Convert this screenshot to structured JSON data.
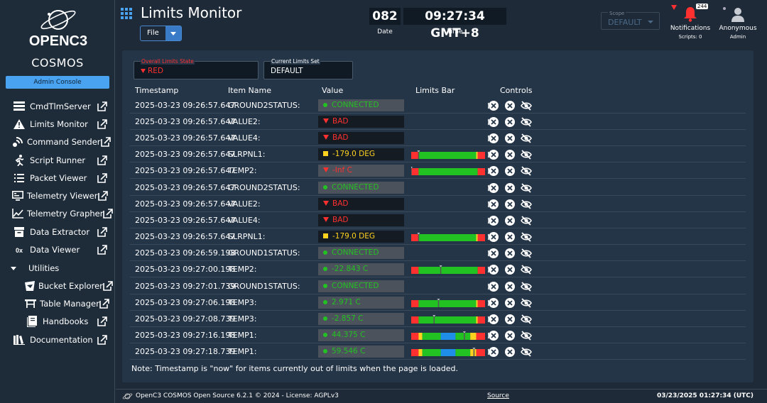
{
  "sidebar": {
    "logo_text": "OPENC3",
    "brand": "COSMOS",
    "admin_label": "Admin Console",
    "items": [
      {
        "label": "CmdTlmServer",
        "icon": "server-icon"
      },
      {
        "label": "Limits Monitor",
        "icon": "warning-icon"
      },
      {
        "label": "Command Sender",
        "icon": "satellite-icon"
      },
      {
        "label": "Script Runner",
        "icon": "runner-icon"
      },
      {
        "label": "Packet Viewer",
        "icon": "list-icon"
      },
      {
        "label": "Telemetry Viewer",
        "icon": "monitor-icon"
      },
      {
        "label": "Telemetry Grapher",
        "icon": "chart-icon"
      },
      {
        "label": "Data Extractor",
        "icon": "archive-icon"
      },
      {
        "label": "Data Viewer",
        "icon": "hex-icon"
      }
    ],
    "utilities_label": "Utilities",
    "utilities": [
      {
        "label": "Bucket Explorer",
        "icon": "bucket-icon"
      },
      {
        "label": "Table Manager",
        "icon": "table-icon"
      },
      {
        "label": "Handbooks",
        "icon": "book-icon"
      }
    ],
    "documentation_label": "Documentation",
    "hex_glyph": "0x"
  },
  "header": {
    "title": "Limits Monitor",
    "file_label": "File",
    "date_value": "082",
    "date_label": "Date",
    "time_value": "09:27:34 GMT+8",
    "time_label": "Time",
    "scope_label": "Scope",
    "scope_value": "DEFAULT",
    "notifications_label": "Notifications",
    "notifications_count": "244",
    "scripts_label": "Scripts: 0",
    "user_label": "Anonymous",
    "user_role": "Admin"
  },
  "limits": {
    "overall_label": "Overall Limits State",
    "overall_value": "RED",
    "current_set_label": "Current Limits Set",
    "current_set_value": "DEFAULT",
    "columns": [
      "Timestamp",
      "Item Name",
      "Value",
      "Limits Bar",
      "Controls"
    ],
    "rows": [
      {
        "ts": "2025-03-23 09:26:57.647",
        "item": "GROUND2STATUS:",
        "value": "CONNECTED",
        "state": "green",
        "bar": null
      },
      {
        "ts": "2025-03-23 09:26:57.647",
        "item": "VALUE2:",
        "value": "BAD",
        "state": "red",
        "bar": null
      },
      {
        "ts": "2025-03-23 09:26:57.647",
        "item": "VALUE4:",
        "value": "BAD",
        "state": "red",
        "bar": null
      },
      {
        "ts": "2025-03-23 09:26:57.647",
        "item": "SLRPNL1:",
        "value": "-179.0 DEG",
        "state": "yellow",
        "bar": {
          "type": "ryg",
          "marker": 0.1
        }
      },
      {
        "ts": "2025-03-23 09:26:57.647",
        "item": "TEMP2:",
        "value": "-Inf C",
        "state": "red",
        "bar": {
          "type": "rg",
          "marker": 0.0
        }
      },
      {
        "ts": "2025-03-23 09:26:57.647",
        "item": "GROUND2STATUS:",
        "value": "CONNECTED",
        "state": "green",
        "bar": null
      },
      {
        "ts": "2025-03-23 09:26:57.647",
        "item": "VALUE2:",
        "value": "BAD",
        "state": "red",
        "bar": null
      },
      {
        "ts": "2025-03-23 09:26:57.647",
        "item": "VALUE4:",
        "value": "BAD",
        "state": "red",
        "bar": null
      },
      {
        "ts": "2025-03-23 09:26:57.647",
        "item": "SLRPNL1:",
        "value": "-179.0 DEG",
        "state": "yellow",
        "bar": {
          "type": "ryg",
          "marker": 0.1
        }
      },
      {
        "ts": "2025-03-23 09:26:59.198",
        "item": "GROUND1STATUS:",
        "value": "CONNECTED",
        "state": "green",
        "bar": null
      },
      {
        "ts": "2025-03-23 09:27:00.198",
        "item": "TEMP2:",
        "value": "-22.843 C",
        "state": "green",
        "bar": {
          "type": "rg",
          "marker": 0.4
        }
      },
      {
        "ts": "2025-03-23 09:27:01.739",
        "item": "GROUND1STATUS:",
        "value": "CONNECTED",
        "state": "green",
        "bar": null
      },
      {
        "ts": "2025-03-23 09:27:06.198",
        "item": "TEMP3:",
        "value": "2.971 C",
        "state": "green",
        "bar": {
          "type": "ryg",
          "marker": 0.37
        }
      },
      {
        "ts": "2025-03-23 09:27:08.739",
        "item": "TEMP3:",
        "value": "-2.857 C",
        "state": "green",
        "bar": {
          "type": "ryg",
          "marker": 0.31
        }
      },
      {
        "ts": "2025-03-23 09:27:16.198",
        "item": "TEMP1:",
        "value": "44.375 C",
        "state": "green",
        "bar": {
          "type": "rygb",
          "marker": 0.72
        }
      },
      {
        "ts": "2025-03-23 09:27:18.739",
        "item": "TEMP1:",
        "value": "59.546 C",
        "state": "green",
        "bar": {
          "type": "rygb",
          "marker": 0.85
        }
      }
    ],
    "note": "Note: Timestamp is \"now\" for items currently out of limits when the page is loaded."
  },
  "footer": {
    "left": "OpenC3 COSMOS Open Source 6.2.1 © 2024 - License: AGPLv3",
    "source": "Source",
    "right": "03/23/2025 01:27:34 (UTC)"
  },
  "colors": {
    "green": "#23c223",
    "red": "#ff3030",
    "yellow": "#ffd21f",
    "blue": "#1f8ee8",
    "accent": "#4aa3f0"
  }
}
